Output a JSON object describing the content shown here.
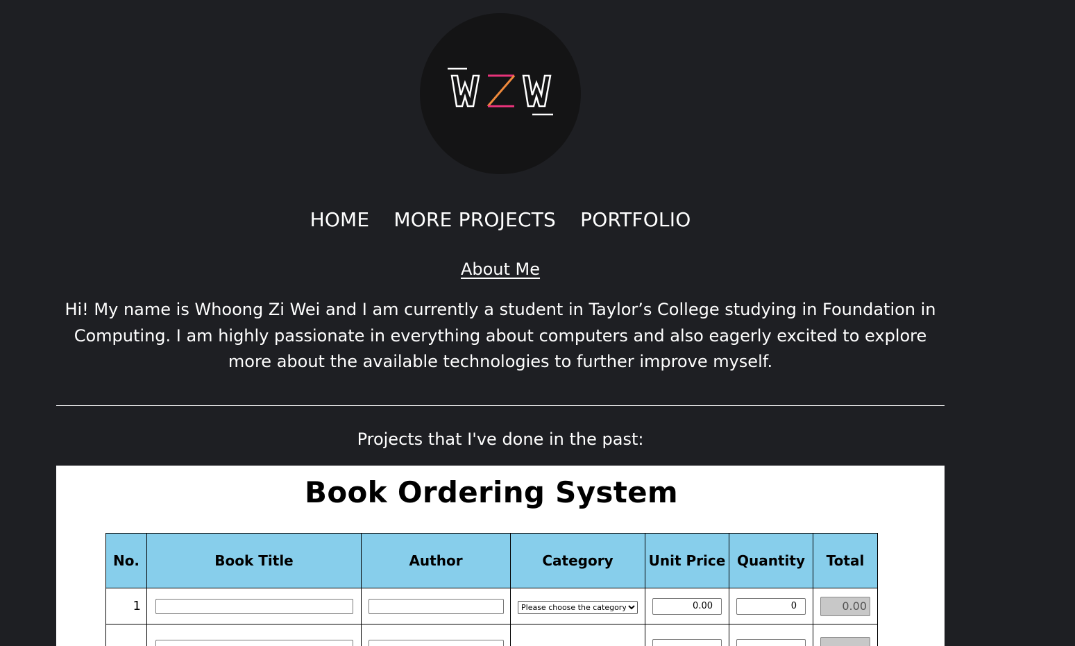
{
  "logo": {
    "icon": "wzw-logo-icon",
    "colors": {
      "stroke": "#ffffff",
      "accent_pink": "#e8337a",
      "accent_orange": "#f08a3c"
    }
  },
  "nav": {
    "items": [
      {
        "label": "HOME"
      },
      {
        "label": "MORE PROJECTS"
      },
      {
        "label": "PORTFOLIO"
      }
    ]
  },
  "about": {
    "title": "About Me",
    "text": "Hi! My name is Whoong Zi Wei and I am currently a student in Taylor’s College studying in Foundation in Computing. I am highly passionate in everything about computers and also eagerly excited to explore more about the available technologies to further improve myself."
  },
  "projects": {
    "heading": "Projects that I've done in the past:",
    "book_ordering": {
      "title": "Book Ordering System",
      "columns": [
        "No.",
        "Book Title",
        "Author",
        "Category",
        "Unit Price",
        "Quantity",
        "Total"
      ],
      "rows": [
        {
          "no": "1",
          "book_title": "",
          "author": "",
          "category": "Please choose the category",
          "unit_price": "0.00",
          "quantity": "0",
          "total": "0.00"
        },
        {
          "no": "",
          "book_title": "",
          "author": "",
          "category": "",
          "unit_price": "",
          "quantity": "",
          "total": ""
        }
      ],
      "colors": {
        "header_bg": "#87ceeb",
        "total_bg": "#c8c8c8"
      }
    }
  }
}
